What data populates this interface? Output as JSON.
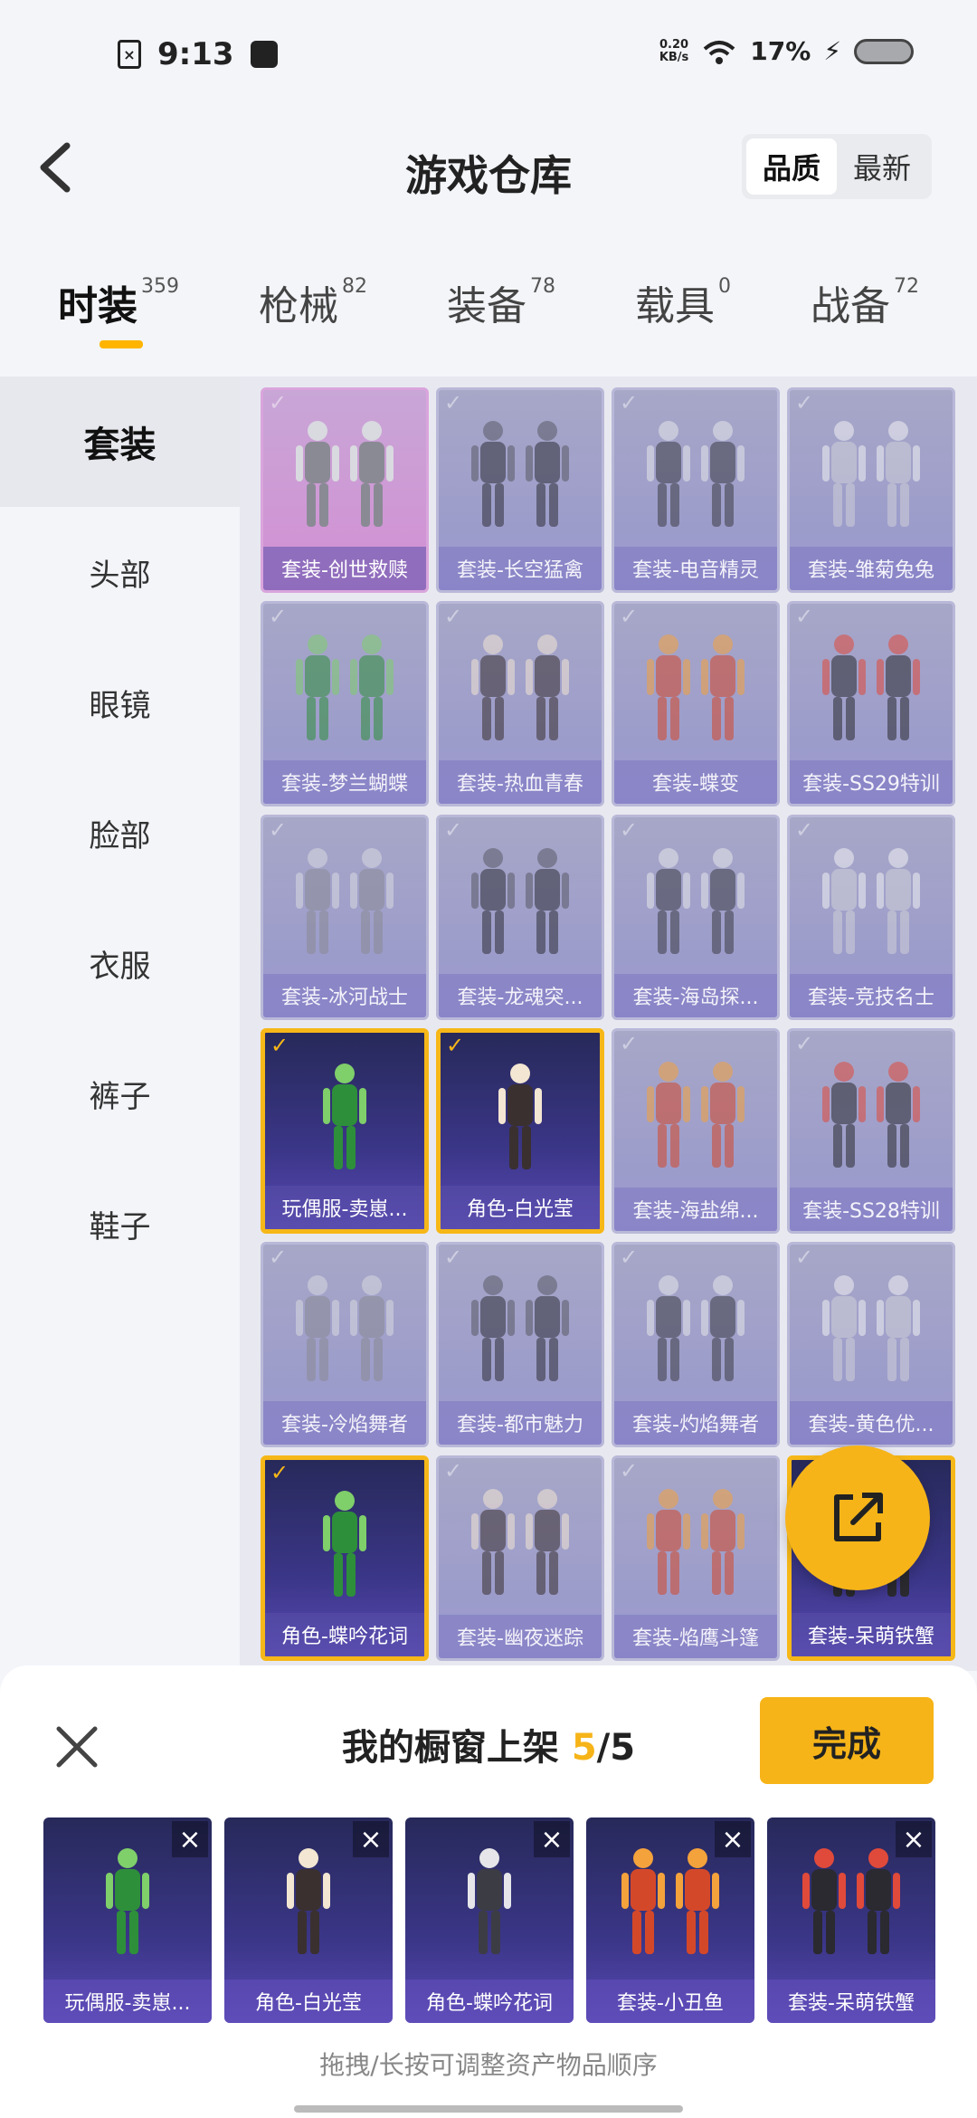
{
  "status_bar": {
    "time": "9:13",
    "net_speed": "0.20\nKB/s",
    "battery": "17%"
  },
  "header": {
    "title": "游戏仓库",
    "sort_options": [
      "品质",
      "最新"
    ],
    "sort_active": 0
  },
  "tabs": [
    {
      "label": "时装",
      "count": "359"
    },
    {
      "label": "枪械",
      "count": "82"
    },
    {
      "label": "装备",
      "count": "78"
    },
    {
      "label": "载具",
      "count": "0"
    },
    {
      "label": "战备",
      "count": "72"
    }
  ],
  "sidebar": [
    "套装",
    "头部",
    "眼镜",
    "脸部",
    "衣服",
    "裤子",
    "鞋子"
  ],
  "grid": [
    {
      "label": "套装-创世救赎",
      "state": "pink"
    },
    {
      "label": "套装-长空猛禽",
      "state": "faded"
    },
    {
      "label": "套装-电音精灵",
      "state": "faded"
    },
    {
      "label": "套装-雏菊兔兔",
      "state": "faded"
    },
    {
      "label": "套装-梦兰蝴蝶",
      "state": "faded"
    },
    {
      "label": "套装-热血青春",
      "state": "faded"
    },
    {
      "label": "套装-蝶变",
      "state": "faded"
    },
    {
      "label": "套装-SS29特训",
      "state": "faded"
    },
    {
      "label": "套装-冰河战士",
      "state": "faded"
    },
    {
      "label": "套装-龙魂突...",
      "state": "faded"
    },
    {
      "label": "套装-海岛探...",
      "state": "faded"
    },
    {
      "label": "套装-竞技名士",
      "state": "faded"
    },
    {
      "label": "玩偶服-卖崽...",
      "state": "selected"
    },
    {
      "label": "角色-白光莹",
      "state": "selected"
    },
    {
      "label": "套装-海盐绵...",
      "state": "faded"
    },
    {
      "label": "套装-SS28特训",
      "state": "faded"
    },
    {
      "label": "套装-冷焰舞者",
      "state": "faded"
    },
    {
      "label": "套装-都市魅力",
      "state": "faded"
    },
    {
      "label": "套装-灼焰舞者",
      "state": "faded"
    },
    {
      "label": "套装-黄色优...",
      "state": "faded"
    },
    {
      "label": "角色-蝶吟花词",
      "state": "selected"
    },
    {
      "label": "套装-幽夜迷踪",
      "state": "faded"
    },
    {
      "label": "套装-焰鹰斗篷",
      "state": "faded"
    },
    {
      "label": "套装-呆萌铁蟹",
      "state": "selected"
    }
  ],
  "sheet": {
    "title": "我的橱窗上架",
    "count": "5",
    "total": "/5",
    "done_label": "完成",
    "hint": "拖拽/长按可调整资产物品顺序",
    "items": [
      "玩偶服-卖崽...",
      "角色-白光莹",
      "角色-蝶吟花词",
      "套装-小丑鱼",
      "套装-呆萌铁蟹"
    ]
  },
  "icons": {
    "back": "chevron-left-icon",
    "share": "share-icon",
    "close": "close-icon",
    "check": "check-icon",
    "remove": "remove-icon"
  },
  "colors": {
    "accent": "#f6b418",
    "selected_card": "#3b3688",
    "faded_card": "#a7a7c8",
    "pink_card": "#d38fd4"
  }
}
